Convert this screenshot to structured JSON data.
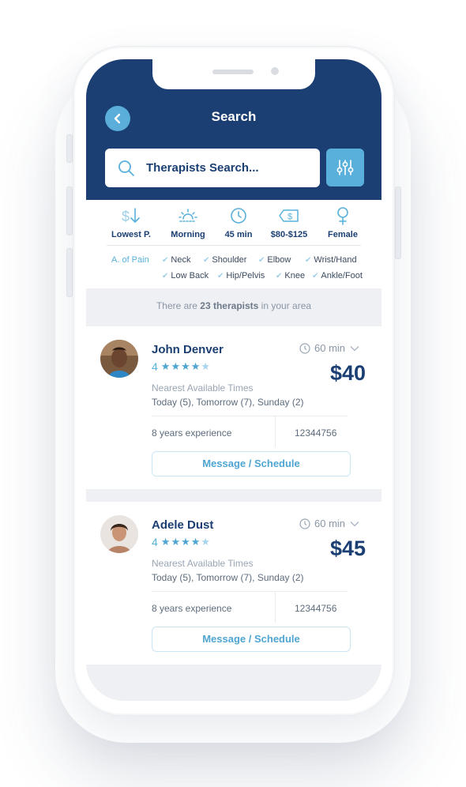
{
  "header": {
    "title": "Search"
  },
  "search": {
    "value": "Therapists Search..."
  },
  "filters": [
    {
      "label": "Lowest P.",
      "icon": "price-sort-icon"
    },
    {
      "label": "Morning",
      "icon": "sunrise-icon"
    },
    {
      "label": "45 min",
      "icon": "clock-icon"
    },
    {
      "label": "$80-$125",
      "icon": "price-tag-icon"
    },
    {
      "label": "Female",
      "icon": "female-icon"
    }
  ],
  "pain": {
    "label": "A. of Pain",
    "areas": [
      "Neck",
      "Shoulder",
      "Elbow",
      "Wrist/Hand",
      "Low Back",
      "Hip/Pelvis",
      "Knee",
      "Ankle/Foot"
    ]
  },
  "results": {
    "prefix": "There are ",
    "count": "23 therapists",
    "suffix": " in your area"
  },
  "therapists": [
    {
      "name": "John Denver",
      "rating": "4",
      "stars": 4,
      "duration": "60 min",
      "price": "$40",
      "availability_label": "Nearest Available Times",
      "times": "Today (5),  Tomorrow (7), Sunday (2)",
      "experience": "8 years experience",
      "license": "12344756",
      "action": "Message / Schedule"
    },
    {
      "name": "Adele Dust",
      "rating": "4",
      "stars": 4,
      "duration": "60 min",
      "price": "$45",
      "availability_label": "Nearest Available Times",
      "times": "Today (5),  Tomorrow (7), Sunday (2)",
      "experience": "8 years experience",
      "license": "12344756",
      "action": "Message / Schedule"
    }
  ],
  "colors": {
    "primary": "#1b3f72",
    "accent": "#59b0da",
    "background": "#eef0f3"
  }
}
